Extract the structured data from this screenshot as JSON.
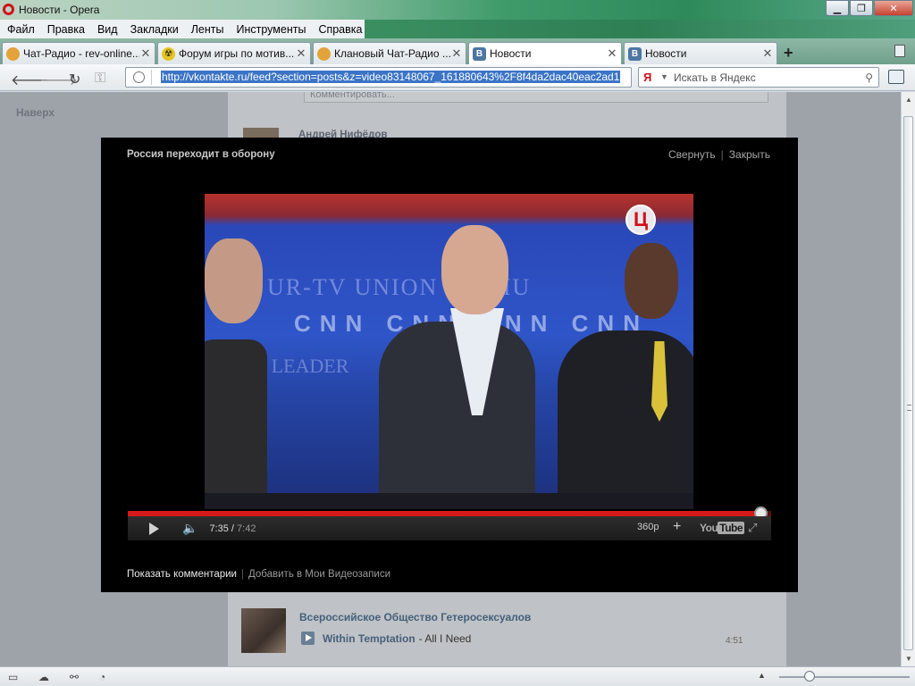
{
  "window": {
    "title": "Новости - Opera",
    "buttons": [
      "minimize",
      "restore",
      "close"
    ]
  },
  "menu": {
    "items": [
      "Файл",
      "Правка",
      "Вид",
      "Закладки",
      "Ленты",
      "Инструменты",
      "Справка"
    ]
  },
  "tabs": [
    {
      "label": "Чат-Радио - rev-online...",
      "icon": "chat-icon",
      "active": false
    },
    {
      "label": "Форум игры по мотив...",
      "icon": "forum-icon",
      "active": false
    },
    {
      "label": "Клановый Чат-Радио ...",
      "icon": "chat-icon",
      "active": false
    },
    {
      "label": "Новости",
      "icon": "vk-icon",
      "active": true
    },
    {
      "label": "Новости",
      "icon": "vk-icon",
      "active": false
    }
  ],
  "address": {
    "url": "http://vkontakte.ru/feed?section=posts&z=video83148067_161880643%2F8f4da2dac40eac2ad1"
  },
  "search": {
    "placeholder": "Искать в Яндекс",
    "engine_letter": "Я"
  },
  "page": {
    "back_to_top": "Наверх",
    "comment_placeholder": "Комментировать...",
    "top_author": "Андрей Нифёдов",
    "post": {
      "author": "Всероссийское Общество Гетеросексуалов",
      "artist": "Within Temptation",
      "song": "- All I Need",
      "duration": "4:51"
    }
  },
  "video": {
    "title": "Россия переходит в оборону",
    "actions": {
      "minimize": "Свернуть",
      "close": "Закрыть"
    },
    "channel_logo": "Ц",
    "background_texts": {
      "station": "UR-TV        UNION        9 WMU",
      "network": "CNN CNN CNN CNN",
      "leader": "ION LEADER"
    },
    "player": {
      "current_time": "7:35",
      "total_time": "7:42",
      "progress": 0.983,
      "quality": "360p",
      "brand_you": "You",
      "brand_tube": "Tube"
    },
    "links": {
      "show_comments": "Показать комментарии",
      "add_to_videos": "Добавить в Мои Видеозаписи"
    }
  },
  "statusbar": {
    "zoom_level": 0.23
  }
}
